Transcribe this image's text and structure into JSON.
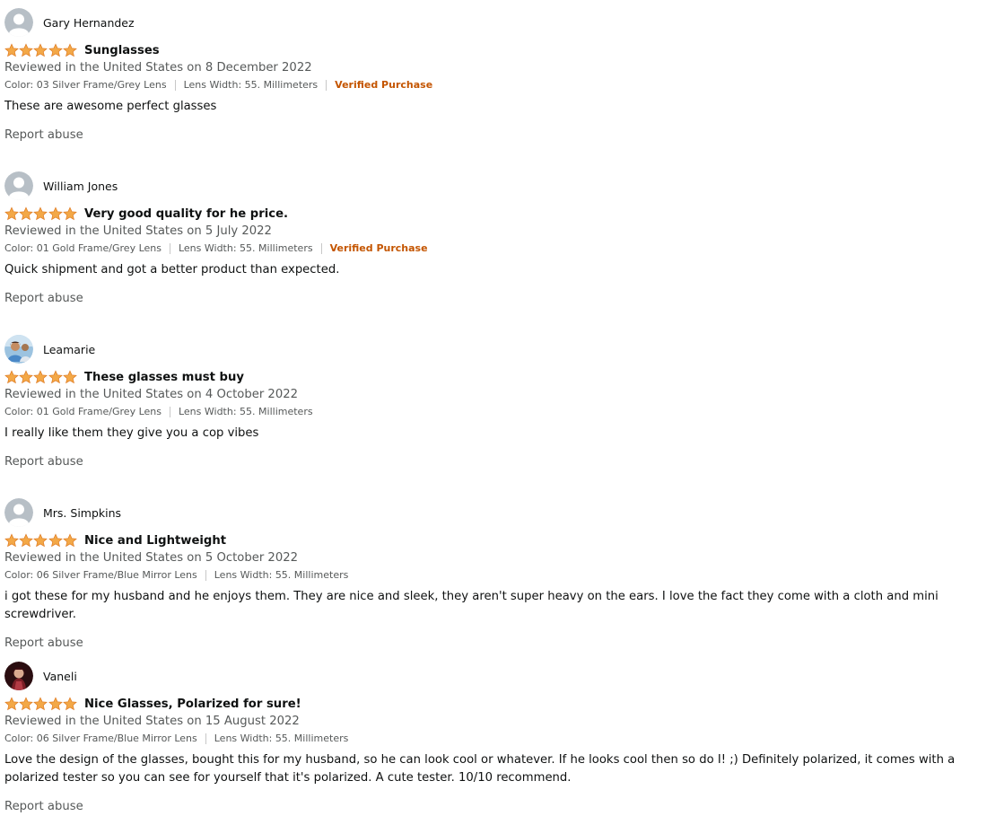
{
  "colors": {
    "star": "#f3a847",
    "verified": "#c45500",
    "secondary_text": "#565959"
  },
  "reviews": [
    {
      "profile_name": "Gary Hernandez",
      "avatar": "default-avatar-icon",
      "rating": 5,
      "title": "Sunglasses",
      "date": "Reviewed in the United States on 8 December 2022",
      "color": "Color: 03 Silver Frame/Grey Lens",
      "lens_width": "Lens Width: 55. Millimeters",
      "verified": "Verified Purchase",
      "body": "These are awesome perfect glasses",
      "report": "Report abuse"
    },
    {
      "profile_name": "William Jones",
      "avatar": "default-avatar-icon",
      "rating": 5,
      "title": "Very good quality for he price.",
      "date": "Reviewed in the United States on 5 July 2022",
      "color": "Color: 01 Gold Frame/Grey Lens",
      "lens_width": "Lens Width: 55. Millimeters",
      "verified": "Verified Purchase",
      "body": "Quick shipment and got a better product than expected.",
      "report": "Report abuse"
    },
    {
      "profile_name": "Leamarie",
      "avatar": "photo-avatar-icon",
      "rating": 5,
      "title": "These glasses must buy",
      "date": "Reviewed in the United States on 4 October 2022",
      "color": "Color: 01 Gold Frame/Grey Lens",
      "lens_width": "Lens Width: 55. Millimeters",
      "verified": "",
      "body": "I really like them they give you a cop vibes",
      "report": "Report abuse"
    },
    {
      "profile_name": "Mrs. Simpkins",
      "avatar": "default-avatar-icon",
      "rating": 5,
      "title": "Nice and Lightweight",
      "date": "Reviewed in the United States on 5 October 2022",
      "color": "Color: 06 Silver Frame/Blue Mirror Lens",
      "lens_width": "Lens Width: 55. Millimeters",
      "verified": "",
      "body": "i got these for my husband and he enjoys them. They are nice and sleek, they aren't super heavy on the ears. I love the fact they come with a cloth and mini screwdriver.",
      "report": "Report abuse"
    },
    {
      "profile_name": "Vaneli",
      "avatar": "photo-avatar-icon",
      "rating": 5,
      "title": "Nice Glasses, Polarized for sure!",
      "date": "Reviewed in the United States on 15 August 2022",
      "color": "Color: 06 Silver Frame/Blue Mirror Lens",
      "lens_width": "Lens Width: 55. Millimeters",
      "verified": "",
      "body": "Love the design of the glasses, bought this for my husband, so he can look cool or whatever. If he looks cool then so do I! ;) Definitely polarized, it comes with a polarized tester so you can see for yourself that it's polarized. A cute tester. 10/10 recommend.",
      "report": "Report abuse"
    }
  ]
}
